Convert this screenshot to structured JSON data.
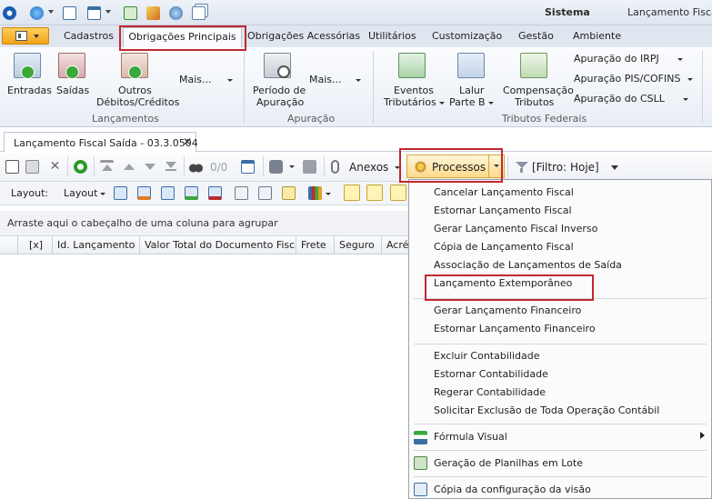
{
  "title": {
    "system": "Sistema",
    "window": "Lançamento Fiscal S"
  },
  "ribbon_tabs": [
    "Cadastros",
    "Obrigações Principais",
    "Obrigações Acessórias",
    "Utilitários",
    "Customização",
    "Gestão",
    "Ambiente"
  ],
  "groups": {
    "lancamentos": {
      "label": "Lançamentos",
      "entradas": "Entradas",
      "saidas": "Saídas",
      "outros_1": "Outros",
      "outros_2": "Débitos/Créditos",
      "mais": "Mais..."
    },
    "apuracao": {
      "label": "Apuração",
      "periodo_1": "Período de",
      "periodo_2": "Apuração",
      "mais": "Mais..."
    },
    "tributos": {
      "label": "Tributos Federais",
      "eventos_1": "Eventos",
      "eventos_2": "Tributários",
      "lalur_1": "Lalur",
      "lalur_2": "Parte B",
      "comp_1": "Compensação",
      "comp_2": "Tributos",
      "irpj": "Apuração do IRPJ",
      "pis": "Apuração PIS/COFINS",
      "csll": "Apuração do CSLL"
    }
  },
  "document_tab": {
    "label": "Lançamento Fiscal Saída - 03.3.0504",
    "close": "✕"
  },
  "toolbar": {
    "counter": "0/0",
    "anexos": "Anexos",
    "processos": "Processos",
    "filtro": "[Filtro: Hoje]"
  },
  "toolbar2": {
    "layout_label": "Layout:",
    "layout_button": "Layout"
  },
  "grid": {
    "group_hint": "Arraste aqui o cabeçalho de uma coluna para agrupar",
    "columns": [
      "[x]",
      "Id. Lançamento",
      "Valor Total do Documento Fiscal",
      "Frete",
      "Seguro",
      "Acré"
    ]
  },
  "menu": {
    "items": [
      "Cancelar Lançamento Fiscal",
      "Estornar Lançamento Fiscal",
      "Gerar Lançamento Fiscal Inverso",
      "Cópia de Lançamento Fiscal",
      "Associação de Lançamentos de Saída",
      "Lançamento Extemporâneo",
      "Gerar Lançamento Financeiro",
      "Estornar Lançamento Financeiro",
      "Excluir Contabilidade",
      "Estornar Contabilidade",
      "Regerar Contabilidade",
      "Solicitar Exclusão de Toda Operação Contábil",
      "Fórmula Visual",
      "Geração de Planilhas em Lote",
      "Cópia da configuração da visão"
    ]
  },
  "colors": {
    "highlight": "#c0282e",
    "accent_orange": "#f3a21b",
    "ribbon_bg": "#e9eef5"
  }
}
